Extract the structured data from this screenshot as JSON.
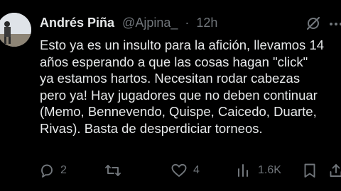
{
  "author": {
    "name": "Andrés Piña",
    "handle": "@Ajpina_",
    "separator": "·",
    "time": "12h"
  },
  "tweet": {
    "lines": [
      "Esto ya es un insulto para la afición, llevamos 14",
      "años esperando a que las cosas hagan \"click\"",
      "ya estamos hartos. Necesitan rodar cabezas",
      "pero ya! Hay jugadores que no deben continuar",
      "(Memo, Bennevendo, Quispe, Caicedo, Duarte,",
      "Rivas). Basta de desperdiciar torneos."
    ]
  },
  "actions": {
    "replies": {
      "icon": "reply-icon",
      "count": "2"
    },
    "reposts": {
      "icon": "repost-icon",
      "count": ""
    },
    "likes": {
      "icon": "heart-icon",
      "count": "4"
    },
    "views": {
      "icon": "views-icon",
      "count": "1.6K"
    },
    "bookmark": {
      "icon": "bookmark-icon"
    },
    "share": {
      "icon": "share-icon"
    }
  },
  "icons": {
    "avatar": "avatar",
    "grok": "grok-icon",
    "more": "more-icon"
  },
  "colors": {
    "background": "#000000",
    "text": "#e7e9ea",
    "muted": "#71767b"
  }
}
